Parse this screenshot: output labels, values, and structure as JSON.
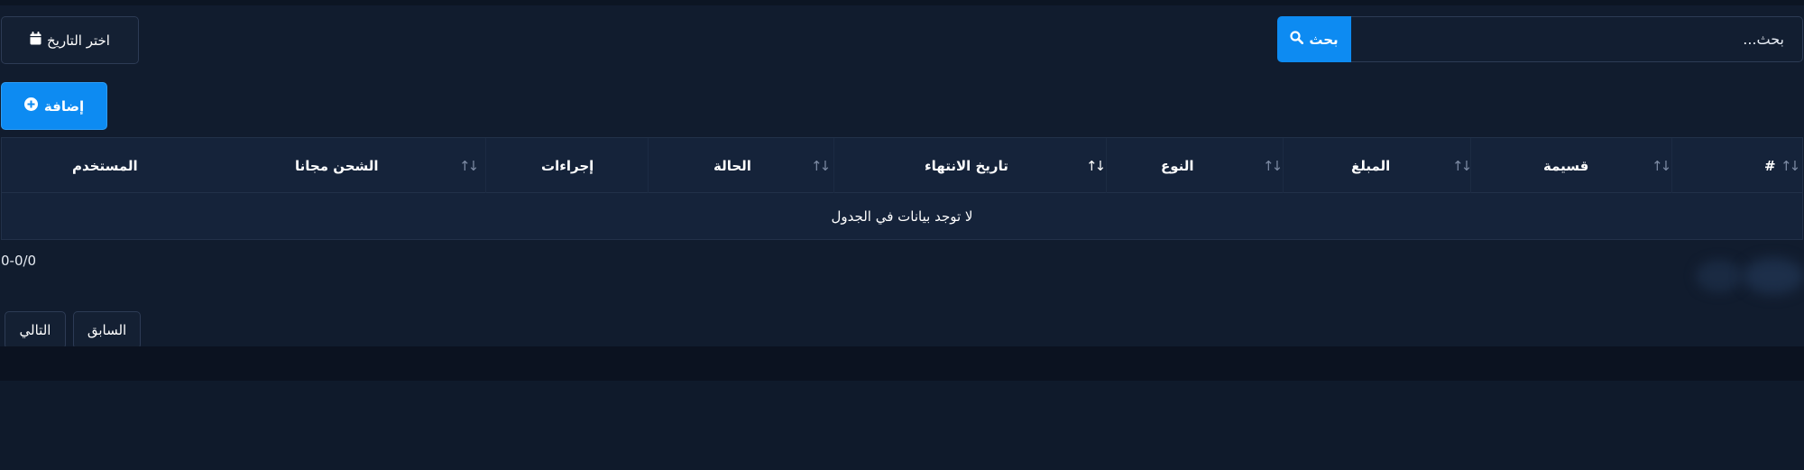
{
  "toolbar": {
    "date_button_label": "اختر التاريخ",
    "add_button_label": "إضافة"
  },
  "search": {
    "button_label": "بحث",
    "placeholder": "بحث..."
  },
  "table": {
    "columns": [
      "#",
      "قسيمة",
      "المبلغ",
      "النوع",
      "تاريخ الانتهاء",
      "الحالة",
      "إجراءات",
      "الشحن مجانا",
      "المستخدم"
    ],
    "empty_message": "لا توجد بيانات في الجدول"
  },
  "pagination": {
    "range_text": "0-0/0",
    "previous_label": "السابق",
    "next_label": "التالي"
  },
  "icons": {
    "calendar": "calendar-icon",
    "search": "search-icon",
    "add": "plus-circle-icon",
    "sort": "sort-icon"
  },
  "colors": {
    "accent": "#0d8bf2",
    "background": "#111c2e",
    "table_header": "#15233a"
  }
}
